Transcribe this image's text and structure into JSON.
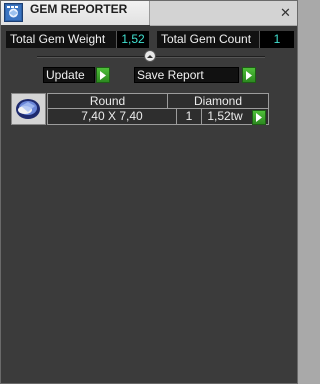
{
  "window": {
    "title": "GEM REPORTER",
    "close_glyph": "✕",
    "app_icon": "gem-reporter-app-icon"
  },
  "stats": {
    "total_weight_label": "Total Gem Weight",
    "total_weight_value": "1,52",
    "total_count_label": "Total Gem Count",
    "total_count_value": "1"
  },
  "actions": {
    "update_label": "Update",
    "save_label": "Save Report"
  },
  "gem_table": {
    "rows": [
      {
        "thumbnail": "gem-thumbnail",
        "shape": "Round",
        "size": "7,40 X 7,40",
        "material": "Diamond",
        "count": "1",
        "weight": "1,52tw"
      }
    ]
  },
  "colors": {
    "value_text": "#40e0d0",
    "play_green": "#3ba12c",
    "panel_bg": "#3b3b3b"
  }
}
